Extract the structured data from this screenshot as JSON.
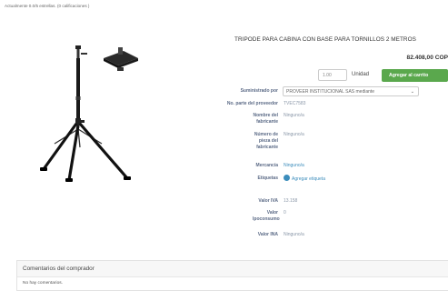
{
  "rating": {
    "text": "Actualmente 0.0/5 estrellas. (0 calificaciones )"
  },
  "product": {
    "title": "TRIPODE PARA CABINA CON BASE PARA TORNILLOS 2 METROS",
    "price": "82.408,00 COP",
    "quantity_value": "1.00",
    "unit_label": "Unidad",
    "add_to_cart_label": "Agregar al carrito"
  },
  "attributes": {
    "supplier_label": "Suministrado por",
    "supplier_value": "PROVEER INSTITUCIONAL SAS mediante",
    "supplier_part_label": "No. parte del proveedor",
    "supplier_part_value": "TVEC7583",
    "manufacturer_name_label": "Nombre del fabricante",
    "manufacturer_name_value": "Ninguno/a",
    "manufacturer_part_label": "Número de pieza del fabricante",
    "manufacturer_part_value": "Ninguno/a",
    "merchandise_label": "Mercancía",
    "merchandise_value": "Ninguno/a",
    "tags_label": "Etiquetas",
    "tags_value": "Agregar etiqueta",
    "iva_label": "Valor IVA",
    "iva_value": "13.158",
    "consumption_label": "Valor Ipoconsumo",
    "consumption_value": "0",
    "iva2_label": "Valor INA",
    "iva2_value": "Ninguno/a"
  },
  "comments": {
    "header": "Comentarios del comprador",
    "empty_text": "No hay comentarios."
  },
  "colors": {
    "accent_green": "#5aa84d",
    "label_blue": "#5b6a86",
    "link_blue": "#3c8dbc"
  },
  "icons": {
    "tag": "tag-icon",
    "caret": "chevron-down-icon"
  }
}
